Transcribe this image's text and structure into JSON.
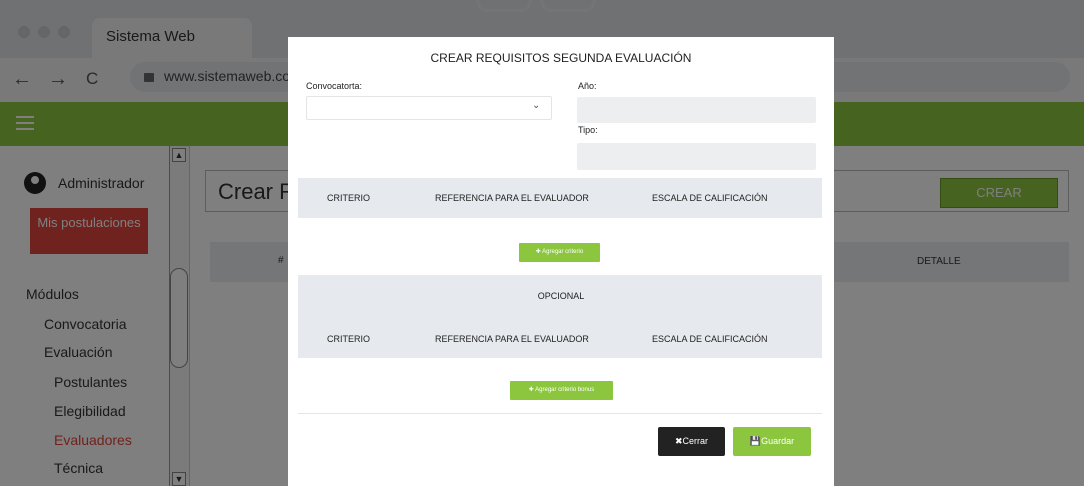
{
  "browser": {
    "tab_title": "Sistema Web",
    "url": "www.sistemaweb.com",
    "back_glyph": "←",
    "forward_glyph": "→",
    "reload_glyph": "C"
  },
  "sidebar": {
    "user_name": "Administrador",
    "mis_postulaciones": "Mis postulaciones",
    "modules_title": "Módulos",
    "items": [
      {
        "label": "Convocatoria"
      },
      {
        "label": "Evaluación"
      },
      {
        "label": "Postulantes"
      },
      {
        "label": "Elegibilidad"
      },
      {
        "label": "Evaluadores"
      },
      {
        "label": "Técnica"
      }
    ]
  },
  "page": {
    "title": "Crear R",
    "crear_button": "CREAR",
    "table_headers": {
      "hash": "#",
      "detalle": "DETALLE"
    }
  },
  "modal": {
    "title": "CREAR REQUISITOS SEGUNDA EVALUACIÓN",
    "convocatoria_label": "Convocatorta:",
    "anio_label": "Año:",
    "tipo_label": "Tipo:",
    "criteria_headers": {
      "criterio": "CRITERIO",
      "referencia": "REFERENCIA PARA EL EVALUADOR",
      "escala": "ESCALA DE CALIFICACIÓN"
    },
    "add_criterio": "✚ Agregar criterio",
    "opcional_label": "OPCIONAL",
    "add_criterio_bonus": "✚ Agregar criterio bonus",
    "cerrar": "✖Cerrar",
    "guardar": "💾Guardar"
  },
  "colors": {
    "accent_green": "#8cc63f",
    "danger_red": "#e0443c",
    "dark_button": "#222222"
  }
}
